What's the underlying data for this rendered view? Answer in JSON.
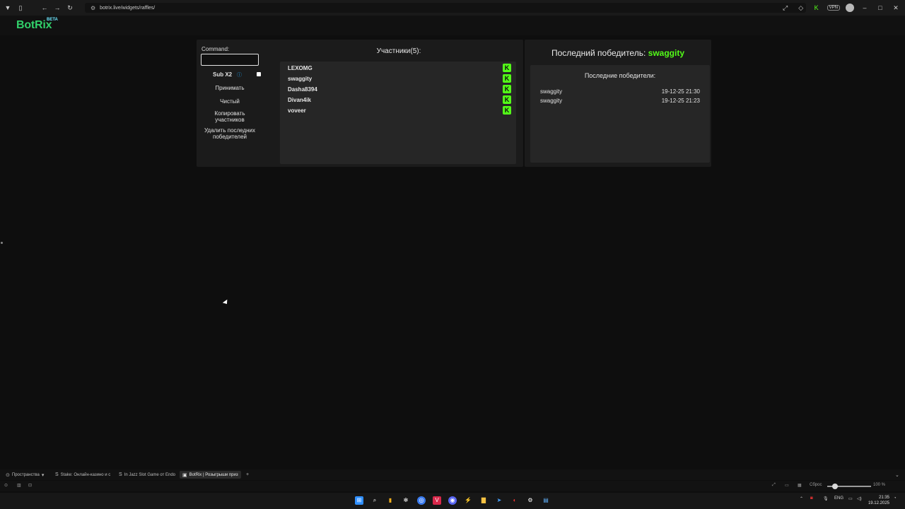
{
  "browser": {
    "url": "botrix.live/widgets/raffles/",
    "vpn_label": "VPN"
  },
  "site": {
    "logo": "BotRix",
    "logo_badge": "BETA"
  },
  "raffle": {
    "command_label": "Command:",
    "command_value": "",
    "sub_label": "Sub X2",
    "buttons": [
      "Принимать",
      "Чистый",
      "Копировать участников",
      "Удалить последних победителей"
    ],
    "participants_title": "Участники(5):",
    "participants": [
      "LEXOMG",
      "swaggity",
      "Dasha8394",
      "Divan4ik",
      "voveer"
    ],
    "badge_letter": "K"
  },
  "winner": {
    "title_prefix": "Последний победитель:",
    "name": "swaggity",
    "recent_title": "Последние победители:",
    "recent": [
      {
        "name": "swaggity",
        "date": "19-12-25 21:30"
      },
      {
        "name": "swaggity",
        "date": "19-12-25 21:23"
      }
    ]
  },
  "tabs": [
    {
      "label": "Пространства",
      "icon": "spaces-icon"
    },
    {
      "label": "Stake: Онлайн-казино и с",
      "icon": "stake-icon"
    },
    {
      "label": "In Jazz Slot Game от Endo",
      "icon": "stake-icon"
    },
    {
      "label": "BotRix | Розыгрыши приз",
      "icon": "botrix-icon"
    }
  ],
  "status": {
    "reset_label": "Сброс",
    "zoom": "100 %"
  },
  "taskbar": {
    "lang": "ENG",
    "time": "21:35",
    "date": "19.12.2025"
  },
  "colors": {
    "accent_green": "#53fc18",
    "logo_green": "#31d06a",
    "panel": "#1b1b1b",
    "box": "#262626"
  }
}
